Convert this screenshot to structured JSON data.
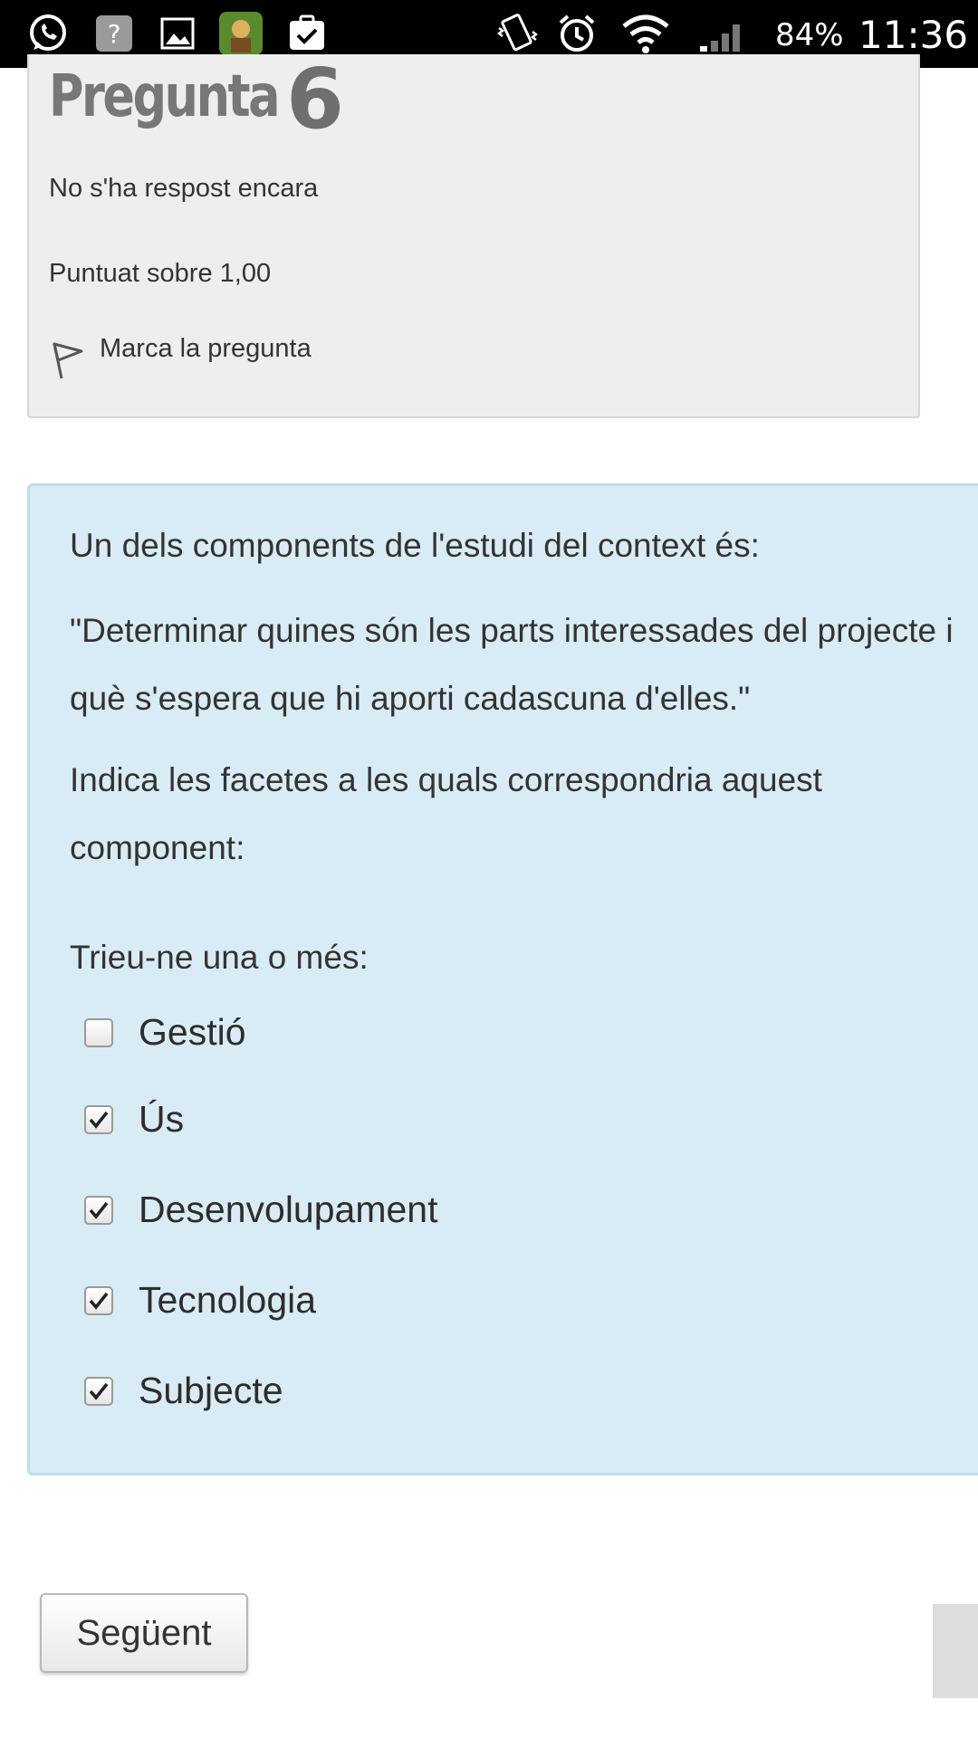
{
  "status_bar": {
    "battery": "84%",
    "time": "11:36"
  },
  "question_info": {
    "title_word": "Pregunta",
    "number": "6",
    "state": "No s'ha respost encara",
    "mark": "Puntuat sobre 1,00",
    "flag_label": "Marca la pregunta"
  },
  "question": {
    "intro": "Un dels components de l'estudi del context és:",
    "quote": "\"Determinar quines són les parts interessades del projecte i què s'espera que hi aporti cadascuna d'elles.\"",
    "instruction": "Indica les facetes a les quals correspondria aquest component:",
    "prompt": "Trieu-ne una o més:",
    "options": [
      {
        "label": "Gestió",
        "checked": false
      },
      {
        "label": "Ús",
        "checked": true
      },
      {
        "label": "Desenvolupament",
        "checked": true
      },
      {
        "label": "Tecnologia",
        "checked": true
      },
      {
        "label": "Subjecte",
        "checked": true
      }
    ]
  },
  "navigation": {
    "next_label": "Següent"
  }
}
